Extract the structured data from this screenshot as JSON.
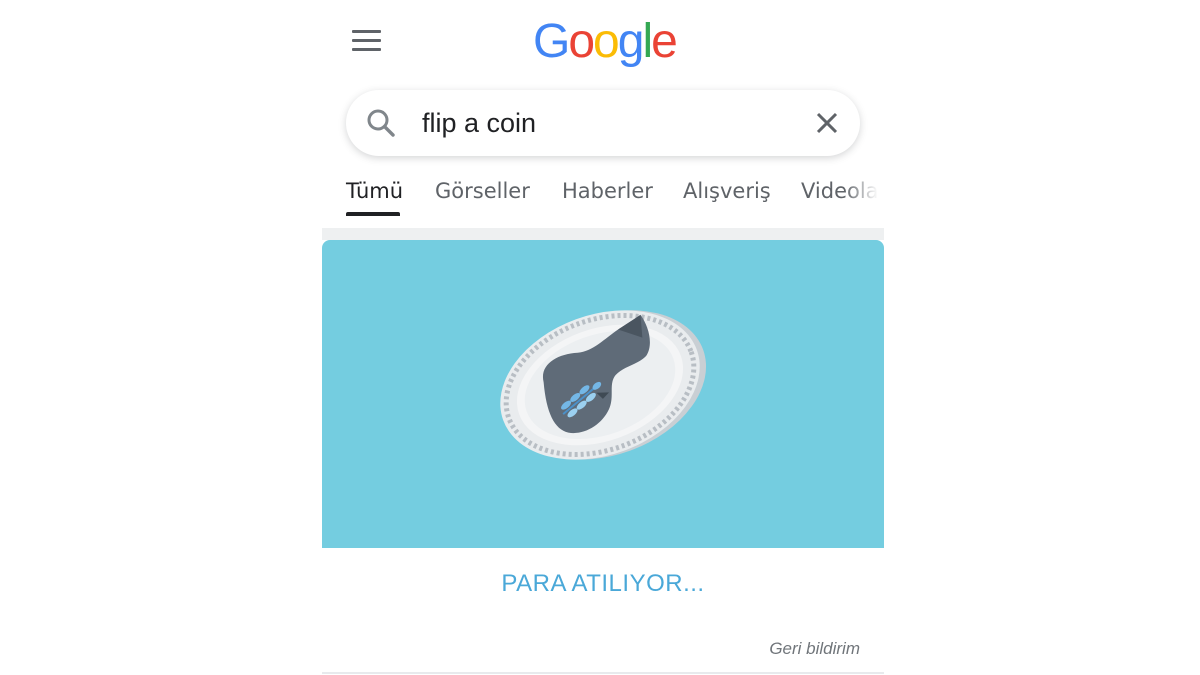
{
  "header": {
    "menu_icon": "hamburger-menu-icon",
    "logo": {
      "letters": [
        "G",
        "o",
        "o",
        "g",
        "l",
        "e"
      ],
      "colors": [
        "#4285F4",
        "#EA4335",
        "#FBBC05",
        "#4285F4",
        "#34A853",
        "#EA4335"
      ]
    }
  },
  "search": {
    "value": "flip a coin",
    "search_icon": "search-icon",
    "clear_icon": "close-icon"
  },
  "tabs": [
    {
      "label": "Tümü",
      "active": true
    },
    {
      "label": "Görseller",
      "active": false
    },
    {
      "label": "Haberler",
      "active": false
    },
    {
      "label": "Alışveriş",
      "active": false
    },
    {
      "label": "Videolar",
      "active": false
    }
  ],
  "coin_widget": {
    "background_color": "#74cde0",
    "coin_icon": "coin-flipping-icon",
    "status": "PARA ATILIYOR...",
    "status_color": "#4aa8d8"
  },
  "footer": {
    "feedback_label": "Geri bildirim"
  }
}
